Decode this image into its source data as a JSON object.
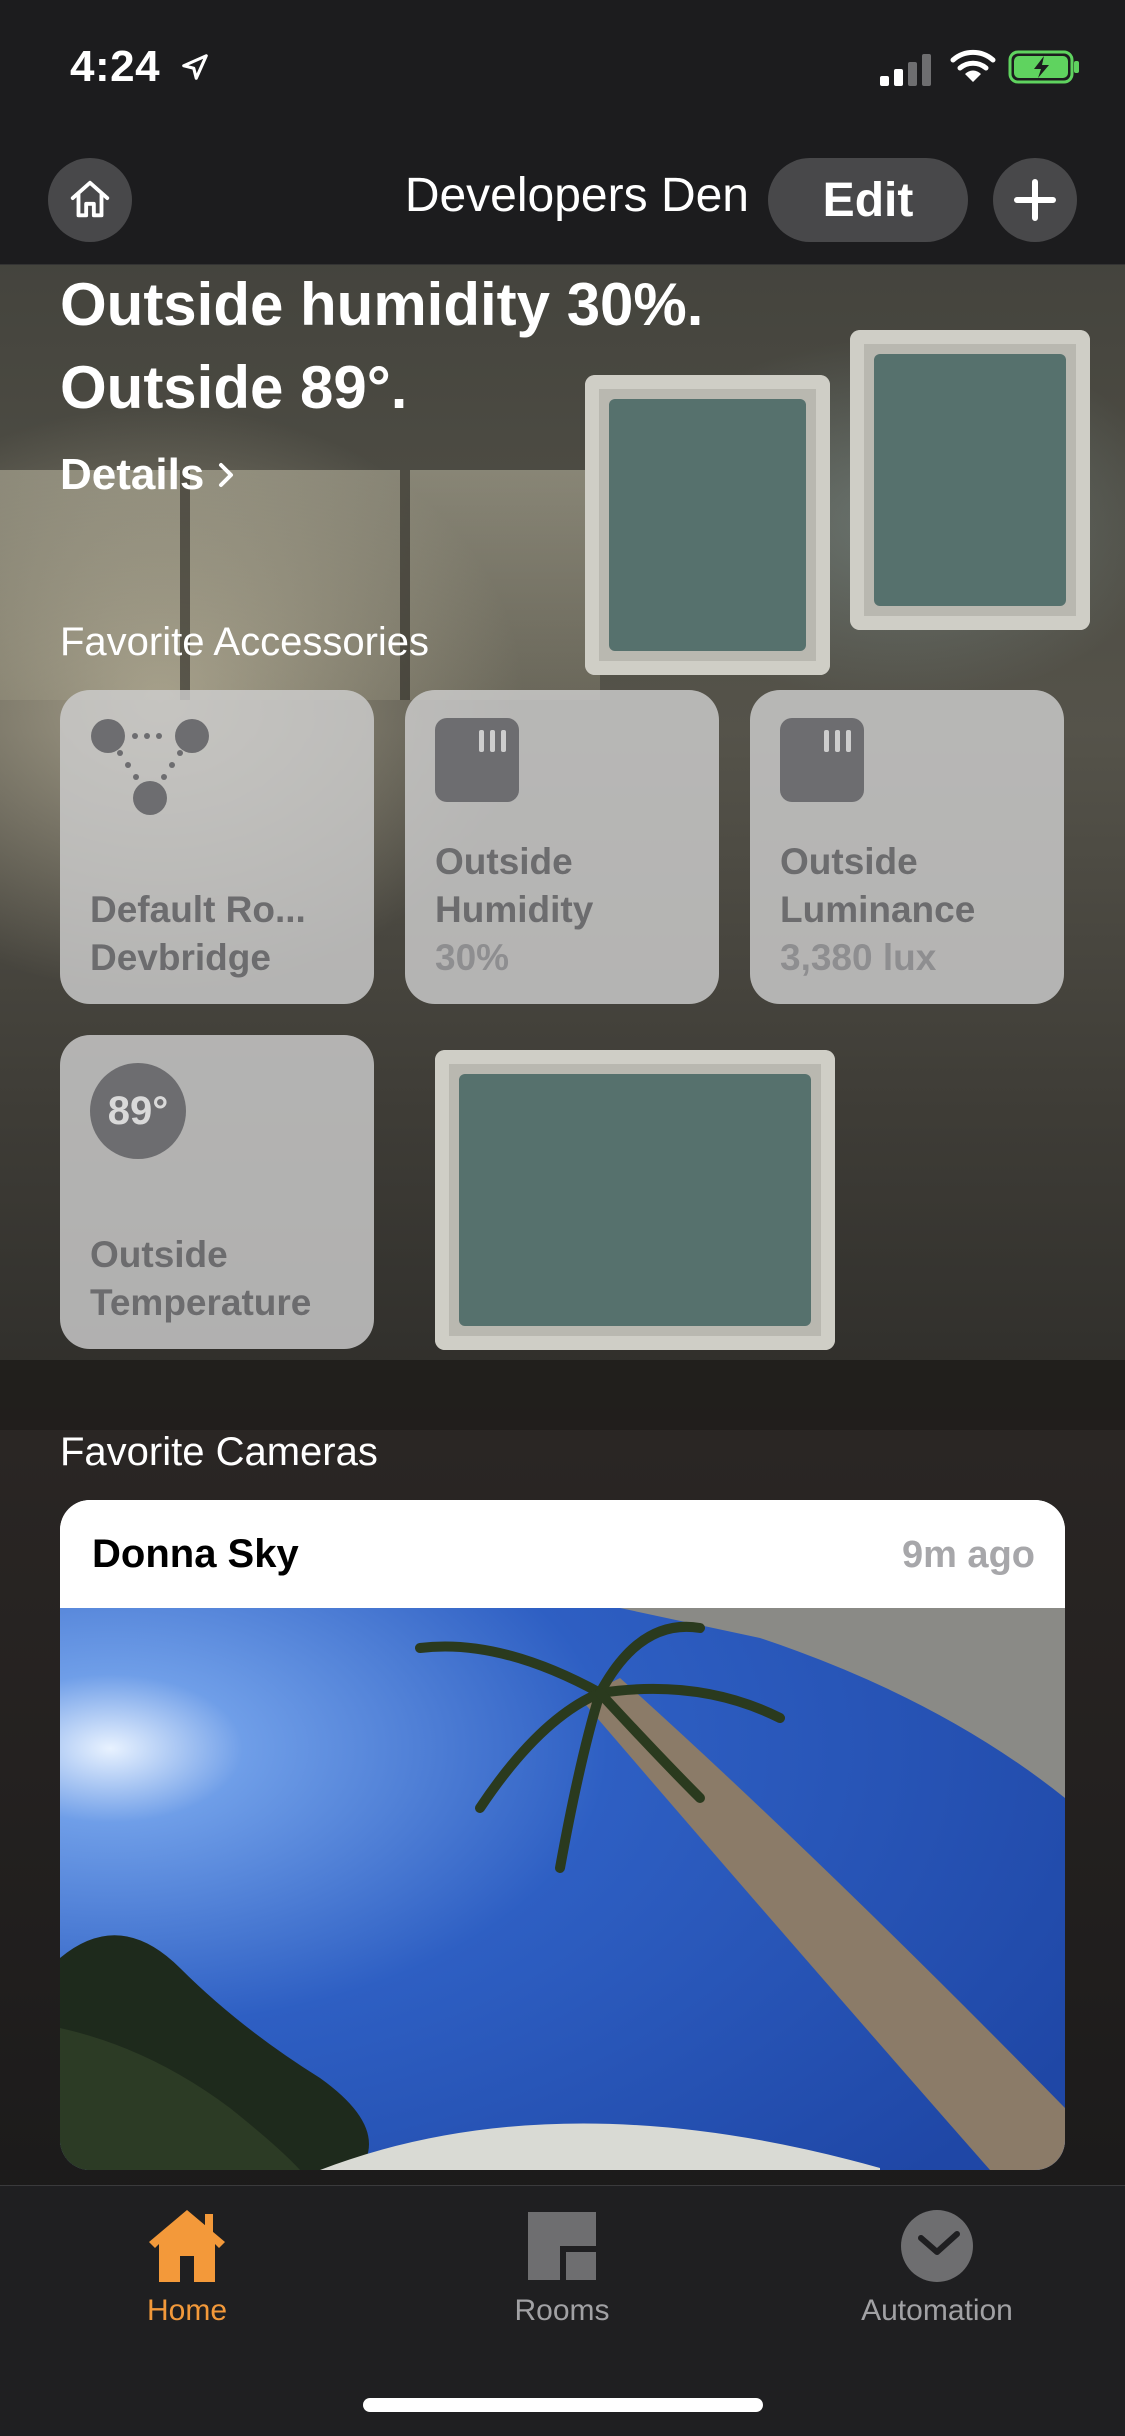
{
  "status_bar": {
    "time": "4:24",
    "icons": [
      "location-arrow-icon",
      "cellular-signal-icon",
      "wifi-icon",
      "battery-charging-icon"
    ]
  },
  "nav": {
    "home_name": "Developers Den",
    "edit_label": "Edit",
    "icons": {
      "home": "house-icon",
      "add": "plus-icon"
    }
  },
  "summary": {
    "line1": "Outside humidity 30%.",
    "line2": "Outside 89°.",
    "details_label": "Details"
  },
  "favorite_accessories": {
    "title": "Favorite Accessories",
    "tiles": [
      {
        "icon": "hub-icon",
        "line1": "Default Ro...",
        "line2": "Devbridge",
        "status": ""
      },
      {
        "icon": "sensor-icon",
        "line1": "Outside",
        "line2": "Humidity",
        "status": "30%"
      },
      {
        "icon": "sensor-icon",
        "line1": "Outside",
        "line2": "Luminance",
        "status": "3,380 lux"
      },
      {
        "icon": "temperature-badge",
        "badge": "89°",
        "line1": "Outside",
        "line2": "Temperature",
        "status": ""
      }
    ]
  },
  "favorite_cameras": {
    "title": "Favorite Cameras",
    "cameras": [
      {
        "name": "Donna Sky",
        "timestamp": "9m ago"
      }
    ]
  },
  "tab_bar": {
    "tabs": [
      {
        "label": "Home",
        "icon": "house-icon",
        "selected": true
      },
      {
        "label": "Rooms",
        "icon": "rooms-icon",
        "selected": false
      },
      {
        "label": "Automation",
        "icon": "automation-check-icon",
        "selected": false
      }
    ]
  },
  "colors": {
    "accent": "#f3993a",
    "tile_bg": "#cdcdcd",
    "bar_bg": "#1c1c1e"
  }
}
